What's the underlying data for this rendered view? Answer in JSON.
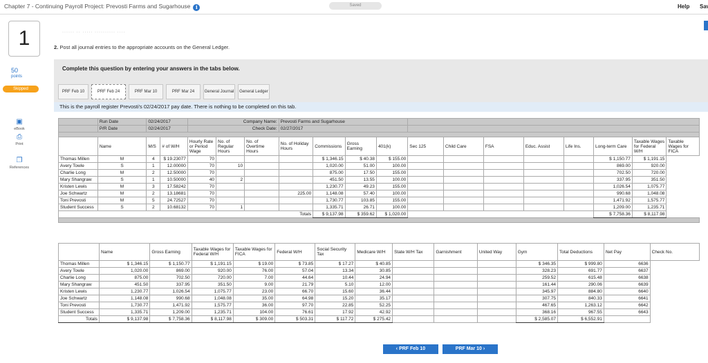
{
  "header": {
    "title": "Chapter 7 - Continuing Payroll Project: Prevosti Farms and Sugarhouse",
    "saved": "Saved",
    "help": "Help",
    "save": "Sav"
  },
  "question": {
    "number": "1",
    "points_value": "50",
    "points_label": "points",
    "skipped": "Skipped",
    "cut_text": "······ ·· ····· ·········· ····",
    "instruction_num": "2.",
    "instruction": "Post all journal entries to the appropriate accounts on the General Ledger.",
    "complete": "Complete this question by entering your answers in the tabs below.",
    "desc": "This is the payroll register Prevosti's 02/24/2017 pay date. There is nothing to be completed on this tab."
  },
  "left_nav": [
    {
      "label": "eBook",
      "icon": "book-icon"
    },
    {
      "label": "Print",
      "icon": "print-icon"
    },
    {
      "label": "References",
      "icon": "references-icon"
    }
  ],
  "tabs": [
    {
      "label": "PRF Feb 10"
    },
    {
      "label": "PRF Feb 24",
      "active": true
    },
    {
      "label": "PRF Mar 10"
    },
    {
      "label": "PRF Mar 24"
    },
    {
      "label": "General Journal"
    },
    {
      "label": "General Ledger"
    }
  ],
  "register": {
    "run_date_label": "Run Date",
    "run_date": "02/24/2017",
    "pr_date_label": "P/R Date",
    "pr_date": "02/24/2017",
    "company_label": "Company Name:",
    "company": "Prevosti Farms and Sugarhouse",
    "check_date_label": "Check Date:",
    "check_date": "02/27/2017",
    "cols1": [
      "Name",
      "M/S",
      "# of W/H",
      "Hourly Rate or Period Wage",
      "No. of Regular Hours",
      "No. of Overtime Hours",
      "No. of Holiday Hours",
      "Commissions",
      "Gross Earning",
      "401(k)",
      "Sec 125",
      "Child Care",
      "FSA",
      "Educ. Assist",
      "Life Ins.",
      "Long-term Care",
      "Taxable Wages for Federal W/H",
      "Taxable Wages for FICA"
    ],
    "rows1": [
      [
        "Thomas Millen",
        "M",
        "4",
        "$ 19.23077",
        "70",
        "",
        "",
        "",
        "$ 1,346.15",
        "$ 40.38",
        "$ 155.00",
        "",
        "",
        "",
        "",
        "",
        "$ 1,150.77",
        "$ 1,191.15"
      ],
      [
        "Avery Towle",
        "S",
        "1",
        "12.00000",
        "70",
        "10",
        "",
        "",
        "1,020.00",
        "51.00",
        "100.00",
        "",
        "",
        "",
        "",
        "",
        "869.00",
        "920.00"
      ],
      [
        "Charlie Long",
        "M",
        "2",
        "12.50000",
        "70",
        "",
        "",
        "",
        "875.00",
        "17.50",
        "155.00",
        "",
        "",
        "",
        "",
        "",
        "702.50",
        "720.00"
      ],
      [
        "Mary Shangraw",
        "S",
        "1",
        "10.50000",
        "40",
        "2",
        "",
        "",
        "451.50",
        "13.55",
        "100.00",
        "",
        "",
        "",
        "",
        "",
        "337.95",
        "351.50"
      ],
      [
        "Kristen Lewis",
        "M",
        "3",
        "17.58242",
        "70",
        "",
        "",
        "",
        "1,230.77",
        "49.23",
        "155.00",
        "",
        "",
        "",
        "",
        "",
        "1,026.54",
        "1,075.77"
      ],
      [
        "Joe Schwartz",
        "M",
        "2",
        "13.18681",
        "70",
        "",
        "",
        "225.00",
        "1,148.08",
        "57.40",
        "100.00",
        "",
        "",
        "",
        "",
        "",
        "990.68",
        "1,048.08"
      ],
      [
        "Toni Prevosti",
        "M",
        "5",
        "24.72527",
        "70",
        "",
        "",
        "",
        "1,730.77",
        "103.85",
        "155.00",
        "",
        "",
        "",
        "",
        "",
        "1,471.92",
        "1,575.77"
      ],
      [
        "Student Success",
        "S",
        "2",
        "10.68132",
        "70",
        "1",
        "",
        "",
        "1,335.71",
        "26.71",
        "100.00",
        "",
        "",
        "",
        "",
        "",
        "1,209.00",
        "1,235.71"
      ]
    ],
    "totals1": {
      "label": "Totals",
      "gross": "$ 9,137.98",
      "k401": "$ 359.62",
      "sec125": "$ 1,020.00",
      "fed": "$ 7,758.36",
      "fica": "$ 8,117.98"
    },
    "cols2": [
      "Name",
      "Gross Earning",
      "Taxable Wages for Federal W/H",
      "Taxable Wages for FICA",
      "Federal W/H",
      "Social Security Tax",
      "Medicare W/H",
      "State W/H Tax",
      "Garnishment",
      "United Way",
      "Gym",
      "Total Deductions",
      "Net Pay",
      "Check No."
    ],
    "rows2": [
      [
        "Thomas Millen",
        "$ 1,346.15",
        "$ 1,150.77",
        "$ 1,191.15",
        "$ 19.00",
        "$ 73.85",
        "$ 17.27",
        "$ 40.85",
        "",
        "",
        "",
        "$ 346.35",
        "$ 999.80",
        "6636"
      ],
      [
        "Avery Towle",
        "1,020.00",
        "869.00",
        "920.00",
        "76.00",
        "57.04",
        "13.34",
        "30.85",
        "",
        "",
        "",
        "328.23",
        "691.77",
        "6637"
      ],
      [
        "Charlie Long",
        "875.00",
        "702.50",
        "720.00",
        "7.00",
        "44.64",
        "10.44",
        "24.94",
        "",
        "",
        "",
        "259.52",
        "615.48",
        "6638"
      ],
      [
        "Mary Shangraw",
        "451.50",
        "337.95",
        "351.50",
        "9.00",
        "21.79",
        "5.10",
        "12.00",
        "",
        "",
        "",
        "161.44",
        "290.06",
        "6639"
      ],
      [
        "Kristen Lewis",
        "1,230.77",
        "1,026.54",
        "1,075.77",
        "23.00",
        "66.70",
        "15.60",
        "36.44",
        "",
        "",
        "",
        "345.97",
        "884.80",
        "6640"
      ],
      [
        "Joe Schwartz",
        "1,148.08",
        "990.68",
        "1,048.08",
        "35.00",
        "64.98",
        "15.20",
        "35.17",
        "",
        "",
        "",
        "307.75",
        "840.33",
        "6641"
      ],
      [
        "Toni Prevosti",
        "1,730.77",
        "1,471.92",
        "1,575.77",
        "36.00",
        "97.70",
        "22.85",
        "52.25",
        "",
        "",
        "",
        "467.65",
        "1,263.12",
        "6642"
      ],
      [
        "Student Success",
        "1,335.71",
        "1,209.00",
        "1,235.71",
        "104.00",
        "76.61",
        "17.92",
        "42.92",
        "",
        "",
        "",
        "368.16",
        "967.55",
        "6643"
      ]
    ],
    "totals2": [
      "Totals",
      "$ 9,137.98",
      "$ 7,758.36",
      "$ 8,117.98",
      "$ 309.00",
      "$ 503.31",
      "$ 117.72",
      "$ 275.42",
      "",
      "",
      "",
      "$ 2,585.07",
      "$ 6,552.91",
      ""
    ]
  },
  "nav": {
    "prev": "‹  PRF Feb 10",
    "next": "PRF Mar 10  ›"
  }
}
